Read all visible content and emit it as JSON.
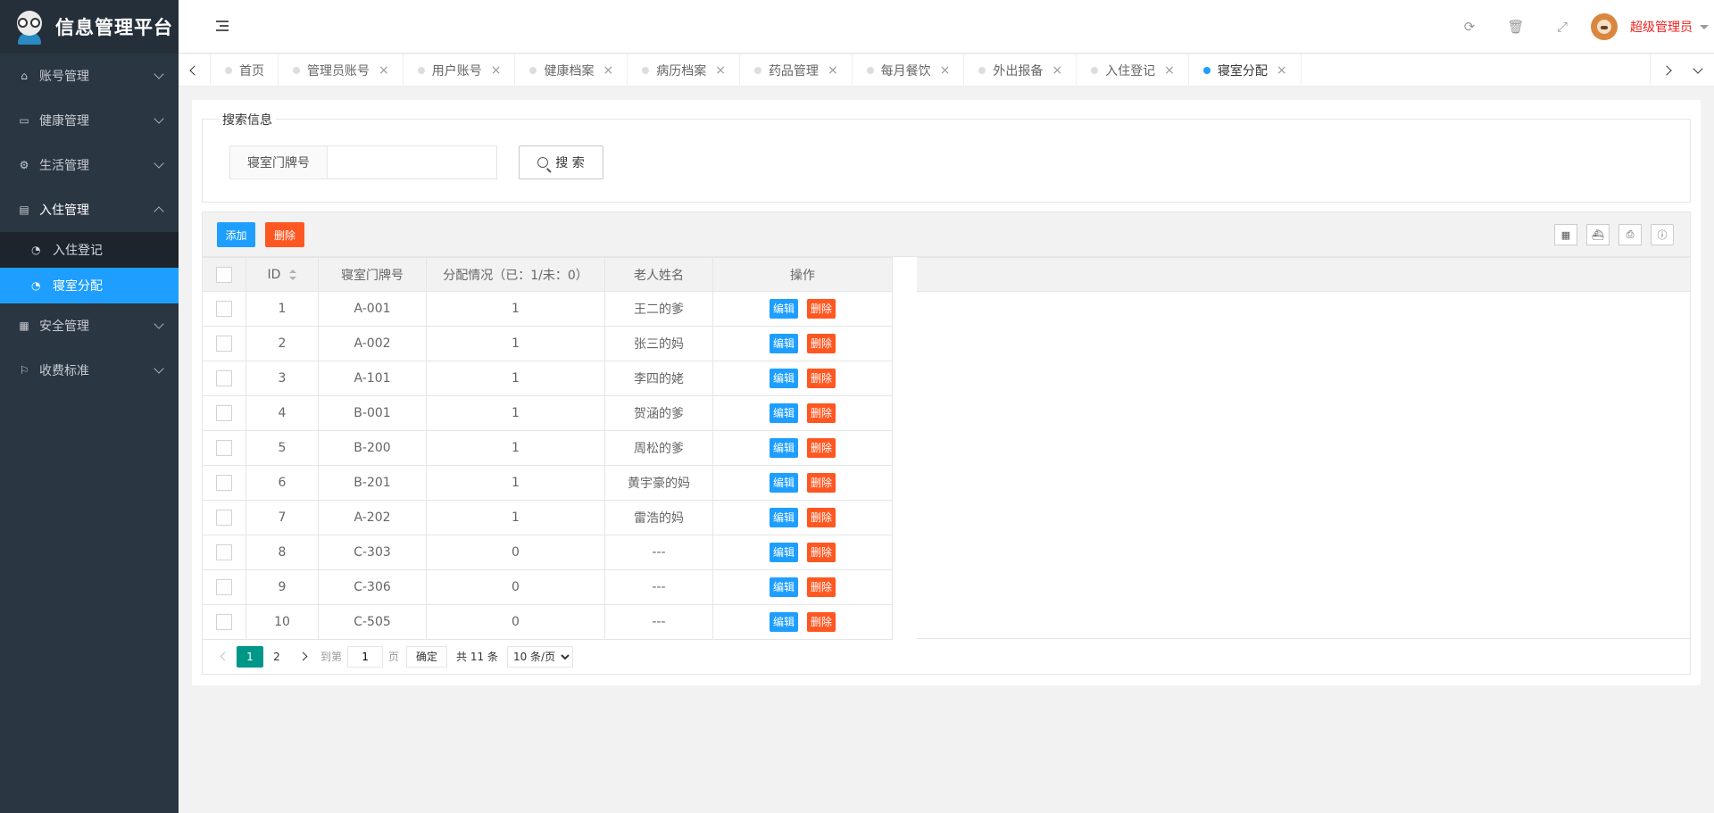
{
  "app": {
    "title": "信息管理平台"
  },
  "sidebar": {
    "menus": [
      {
        "label": "账号管理",
        "icon": "home-icon"
      },
      {
        "label": "健康管理",
        "icon": "window-icon"
      },
      {
        "label": "生活管理",
        "icon": "gears-icon"
      },
      {
        "label": "入住管理",
        "icon": "file-icon"
      },
      {
        "label": "安全管理",
        "icon": "calendar-icon"
      },
      {
        "label": "收费标准",
        "icon": "flag-icon"
      }
    ],
    "submenu": [
      {
        "label": "入住登记",
        "icon": "dashboard-icon"
      },
      {
        "label": "寝室分配",
        "icon": "dashboard-icon"
      }
    ]
  },
  "header": {
    "username": "超级管理员"
  },
  "tabs": [
    {
      "label": "首页"
    },
    {
      "label": "管理员账号"
    },
    {
      "label": "用户账号"
    },
    {
      "label": "健康档案"
    },
    {
      "label": "病历档案"
    },
    {
      "label": "药品管理"
    },
    {
      "label": "每月餐饮"
    },
    {
      "label": "外出报备"
    },
    {
      "label": "入住登记"
    },
    {
      "label": "寝室分配"
    }
  ],
  "search": {
    "legend": "搜索信息",
    "label": "寝室门牌号",
    "value": "",
    "button": "搜 索"
  },
  "toolbar": {
    "add": "添加",
    "delete": "删除"
  },
  "table": {
    "columns": [
      "ID",
      "寝室门牌号",
      "分配情况（已：1/未：0）",
      "老人姓名",
      "操作"
    ],
    "edit_label": "编辑",
    "delete_label": "删除",
    "rows": [
      {
        "id": "1",
        "room": "A-001",
        "status": "1",
        "name": "王二的爹"
      },
      {
        "id": "2",
        "room": "A-002",
        "status": "1",
        "name": "张三的妈"
      },
      {
        "id": "3",
        "room": "A-101",
        "status": "1",
        "name": "李四的姥"
      },
      {
        "id": "4",
        "room": "B-001",
        "status": "1",
        "name": "贺涵的爹"
      },
      {
        "id": "5",
        "room": "B-200",
        "status": "1",
        "name": "周松的爹"
      },
      {
        "id": "6",
        "room": "B-201",
        "status": "1",
        "name": "黄宇豪的妈"
      },
      {
        "id": "7",
        "room": "A-202",
        "status": "1",
        "name": "雷浩的妈"
      },
      {
        "id": "8",
        "room": "C-303",
        "status": "0",
        "name": "---"
      },
      {
        "id": "9",
        "room": "C-306",
        "status": "0",
        "name": "---"
      },
      {
        "id": "10",
        "room": "C-505",
        "status": "0",
        "name": "---"
      }
    ]
  },
  "pager": {
    "pages": [
      "1",
      "2"
    ],
    "goto_prefix": "到第",
    "goto_value": "1",
    "goto_suffix": "页",
    "confirm": "确定",
    "total": "共 11 条",
    "page_size": "10 条/页"
  }
}
